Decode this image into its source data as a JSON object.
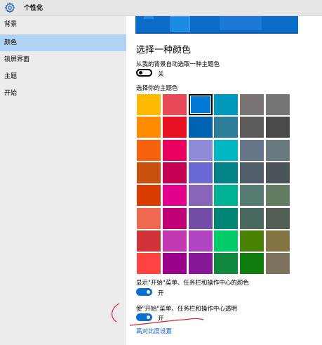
{
  "window": {
    "title": "个性化",
    "icon": "gear-icon",
    "accent": "#0b6fd1"
  },
  "sidebar": {
    "items": [
      {
        "label": "背景",
        "selected": false
      },
      {
        "label": "颜色",
        "selected": true
      },
      {
        "label": "锁屏界面",
        "selected": false
      },
      {
        "label": "主题",
        "selected": false
      },
      {
        "label": "开始",
        "selected": false
      }
    ]
  },
  "main": {
    "heading": "选择一种颜色",
    "auto_pick": {
      "label": "从我的背景自动选取一种主题色",
      "state": "关",
      "on": false
    },
    "palette_label": "选择你的主题色",
    "palette": [
      [
        "#ffb900",
        "#e74856",
        "#0078d7",
        "#0099bc",
        "#7a7574",
        "#767676"
      ],
      [
        "#ff8c00",
        "#e81123",
        "#0063b1",
        "#2d7d9a",
        "#5d5a58",
        "#4c4a48"
      ],
      [
        "#f7630c",
        "#ea005e",
        "#8e8cd8",
        "#00b7c3",
        "#68768a",
        "#69797e"
      ],
      [
        "#ca5010",
        "#c30052",
        "#6b69d6",
        "#038387",
        "#515c6b",
        "#4a5459"
      ],
      [
        "#da3b01",
        "#e3008c",
        "#8764b8",
        "#00b294",
        "#567c73",
        "#647c64"
      ],
      [
        "#ef6950",
        "#bf0077",
        "#744da9",
        "#018574",
        "#486860",
        "#525e54"
      ],
      [
        "#d13438",
        "#c239b3",
        "#b146c2",
        "#00cc6a",
        "#498205",
        "#847545"
      ],
      [
        "#ff4343",
        "#9a0089",
        "#881798",
        "#10893e",
        "#107c10",
        "#7e735f"
      ]
    ],
    "selected_color": "#0078d7",
    "show_color": {
      "label": "显示\"开始\"菜单、任务栏和操作中心的颜色",
      "state": "开",
      "on": true
    },
    "transparent": {
      "label": "使\"开始\"菜单、任务栏和操作中心透明",
      "state": "开",
      "on": true
    },
    "high_contrast_link": "高对比度设置"
  },
  "annotation": {
    "color": "#d8232a"
  }
}
